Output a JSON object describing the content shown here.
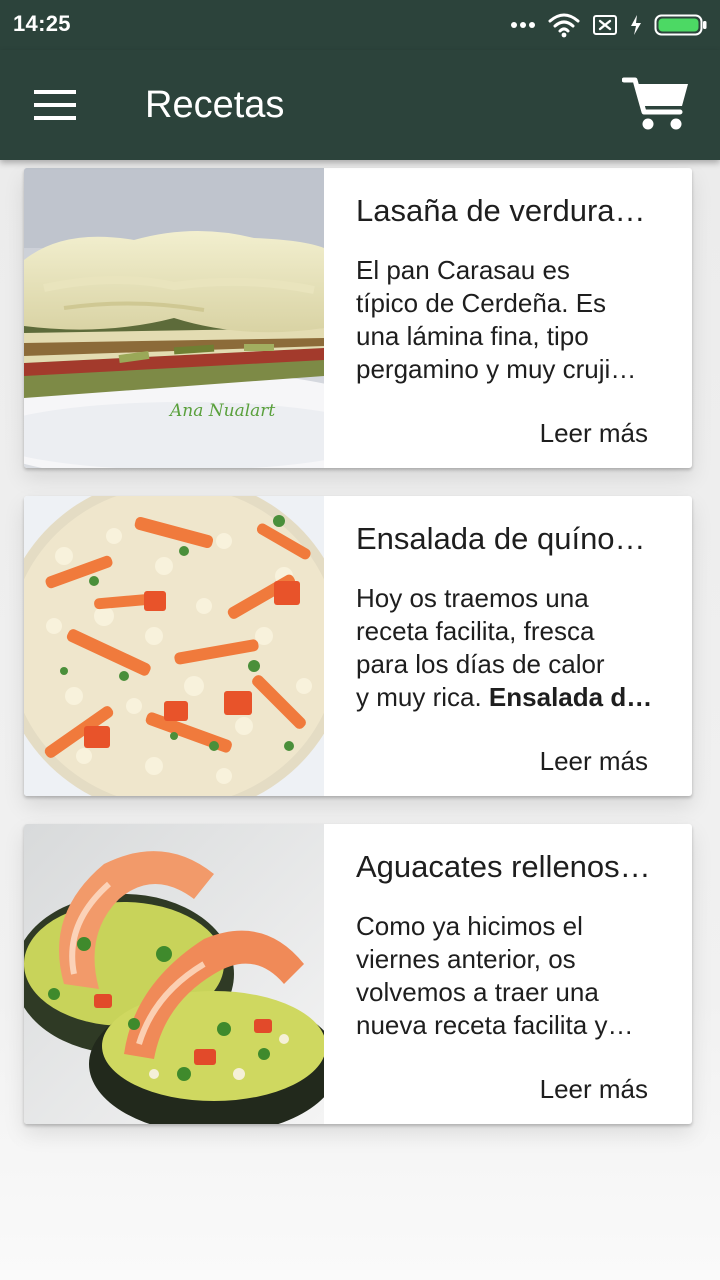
{
  "status_bar": {
    "time": "14:25",
    "icons": [
      "more-dots-icon",
      "wifi-icon",
      "sim-blocked-icon",
      "charging-icon",
      "battery-icon"
    ],
    "battery_color": "#4cd964"
  },
  "app_bar": {
    "title": "Recetas",
    "menu_icon": "hamburger-menu-icon",
    "cart_icon": "shopping-cart-icon",
    "background": "#2c433b"
  },
  "recipes": [
    {
      "title": "Lasaña de verdura…",
      "description_lines": [
        "El pan Carasau es",
        "típico de Cerdeña. Es",
        "una lámina fina, tipo",
        "pergamino y muy cruji…"
      ],
      "image_watermark": "Ana Nualart",
      "read_more": "Leer más"
    },
    {
      "title": "Ensalada de quíno…",
      "description_lines": [
        "Hoy os traemos una",
        "receta facilita, fresca",
        "para los días de calor"
      ],
      "description_last_plain": "y muy rica. ",
      "description_last_bold": "Ensalada d…",
      "read_more": "Leer más"
    },
    {
      "title": "Aguacates rellenos…",
      "description_lines": [
        "Como ya hicimos el",
        "viernes anterior, os",
        "volvemos a traer una",
        "nueva receta facilita y…"
      ],
      "read_more": "Leer más"
    }
  ]
}
